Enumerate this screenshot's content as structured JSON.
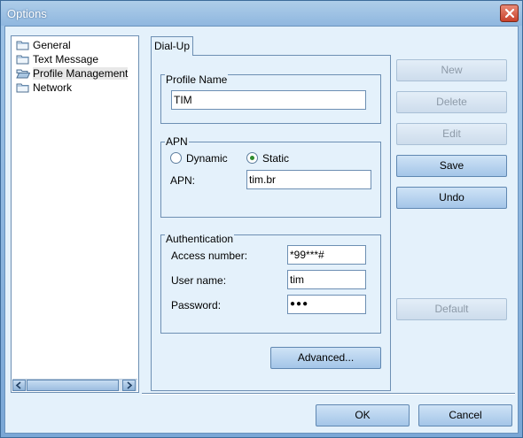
{
  "window": {
    "title": "Options"
  },
  "tree": {
    "items": [
      {
        "label": "General",
        "icon": "folder-icon"
      },
      {
        "label": "Text Message",
        "icon": "folder-icon"
      },
      {
        "label": "Profile Management",
        "icon": "folder-open-icon",
        "selected": true
      },
      {
        "label": "Network",
        "icon": "folder-icon"
      }
    ]
  },
  "tabs": [
    {
      "label": "Dial-Up",
      "active": true
    }
  ],
  "profile": {
    "group_label": "Profile Name",
    "name_value": "TIM"
  },
  "apn": {
    "group_label": "APN",
    "dynamic_label": "Dynamic",
    "static_label": "Static",
    "selected": "Static",
    "field_label": "APN:",
    "value": "tim.br"
  },
  "auth": {
    "group_label": "Authentication",
    "access_label": "Access number:",
    "access_value": "*99***#",
    "user_label": "User name:",
    "user_value": "tim",
    "password_label": "Password:",
    "password_value": "●●●"
  },
  "buttons": {
    "new": "New",
    "delete": "Delete",
    "edit": "Edit",
    "save": "Save",
    "undo": "Undo",
    "default": "Default",
    "advanced": "Advanced...",
    "ok": "OK",
    "cancel": "Cancel"
  },
  "colors": {
    "client_bg": "#e4f1fb",
    "border": "#6d8fb3",
    "close": "#c8412b",
    "radio_dot": "#2f8c2f"
  }
}
